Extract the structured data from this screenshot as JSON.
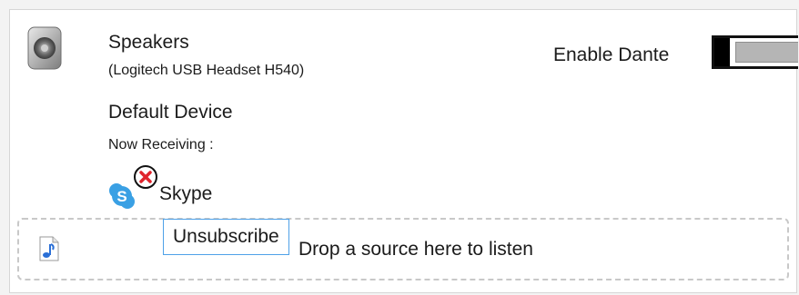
{
  "device": {
    "icon": "speaker-icon",
    "name": "Speakers",
    "model": "(Logitech USB Headset H540)",
    "status": "Default Device",
    "receiving_label": "Now Receiving :"
  },
  "dante": {
    "label": "Enable Dante",
    "enabled": false
  },
  "sources": [
    {
      "name": "Skype",
      "icon": "skype-icon",
      "action_icon": "unsubscribe-x-icon"
    }
  ],
  "tooltip": {
    "text": "Unsubscribe"
  },
  "drop_zone": {
    "icon": "music-note-icon",
    "text": "Drop a source here to listen"
  },
  "colors": {
    "tooltip_border": "#4ea1e8",
    "skype_blue": "#3aa0e4",
    "unsubscribe_red": "#e0242c"
  }
}
